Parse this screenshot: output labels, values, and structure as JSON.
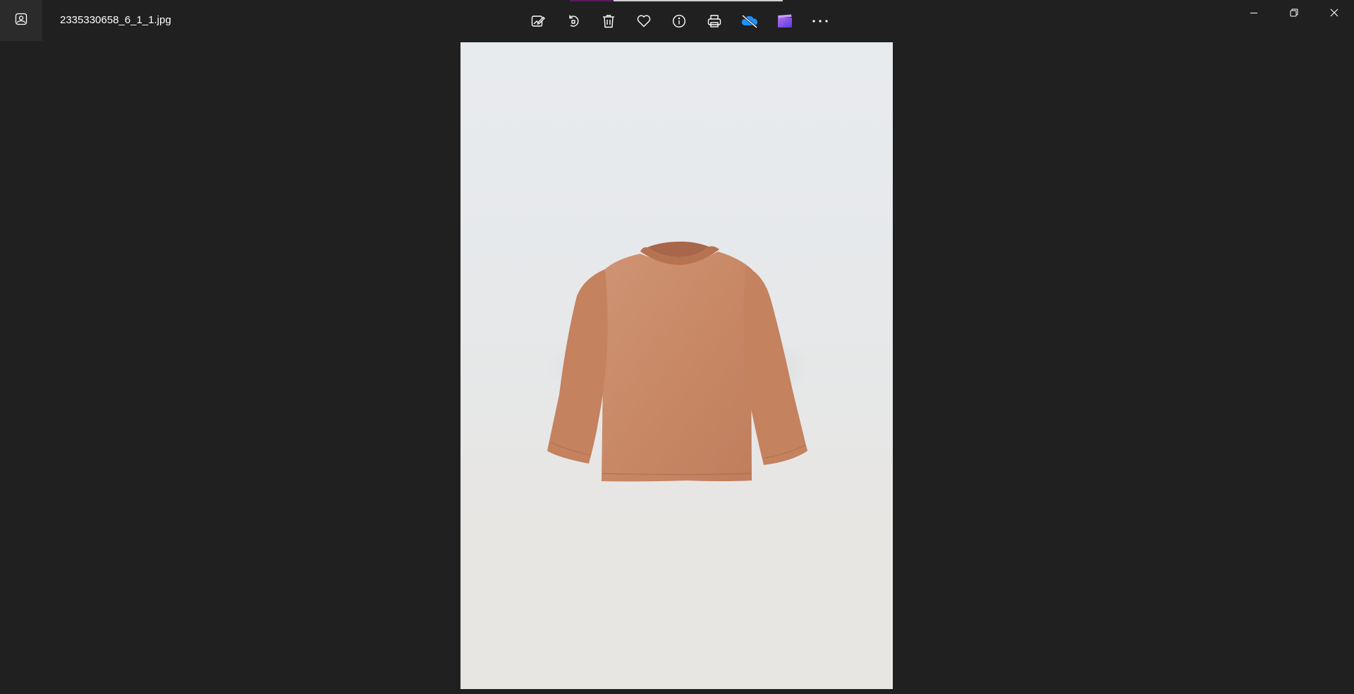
{
  "window": {
    "file_name": "2335330658_6_1_1.jpg"
  },
  "toolbar": {
    "buttons": [
      {
        "name": "edit-image-button",
        "icon": "edit-image-icon"
      },
      {
        "name": "rotate-button",
        "icon": "rotate-icon"
      },
      {
        "name": "delete-button",
        "icon": "trash-icon"
      },
      {
        "name": "favorite-button",
        "icon": "heart-icon"
      },
      {
        "name": "file-info-button",
        "icon": "info-icon"
      },
      {
        "name": "print-button",
        "icon": "printer-icon"
      },
      {
        "name": "onedrive-button",
        "icon": "cloud-off-icon"
      },
      {
        "name": "clipchamp-button",
        "icon": "clipchamp-icon"
      },
      {
        "name": "more-options-button",
        "icon": "more-icon"
      }
    ]
  },
  "colors": {
    "background": "#202020",
    "icon": "#ffffff",
    "onedrive_accent": "#1e90ff",
    "clipchamp_accent": "#8a5cf6",
    "garment": "#c98a68"
  },
  "photo": {
    "subject": "long-sleeve-tshirt"
  }
}
